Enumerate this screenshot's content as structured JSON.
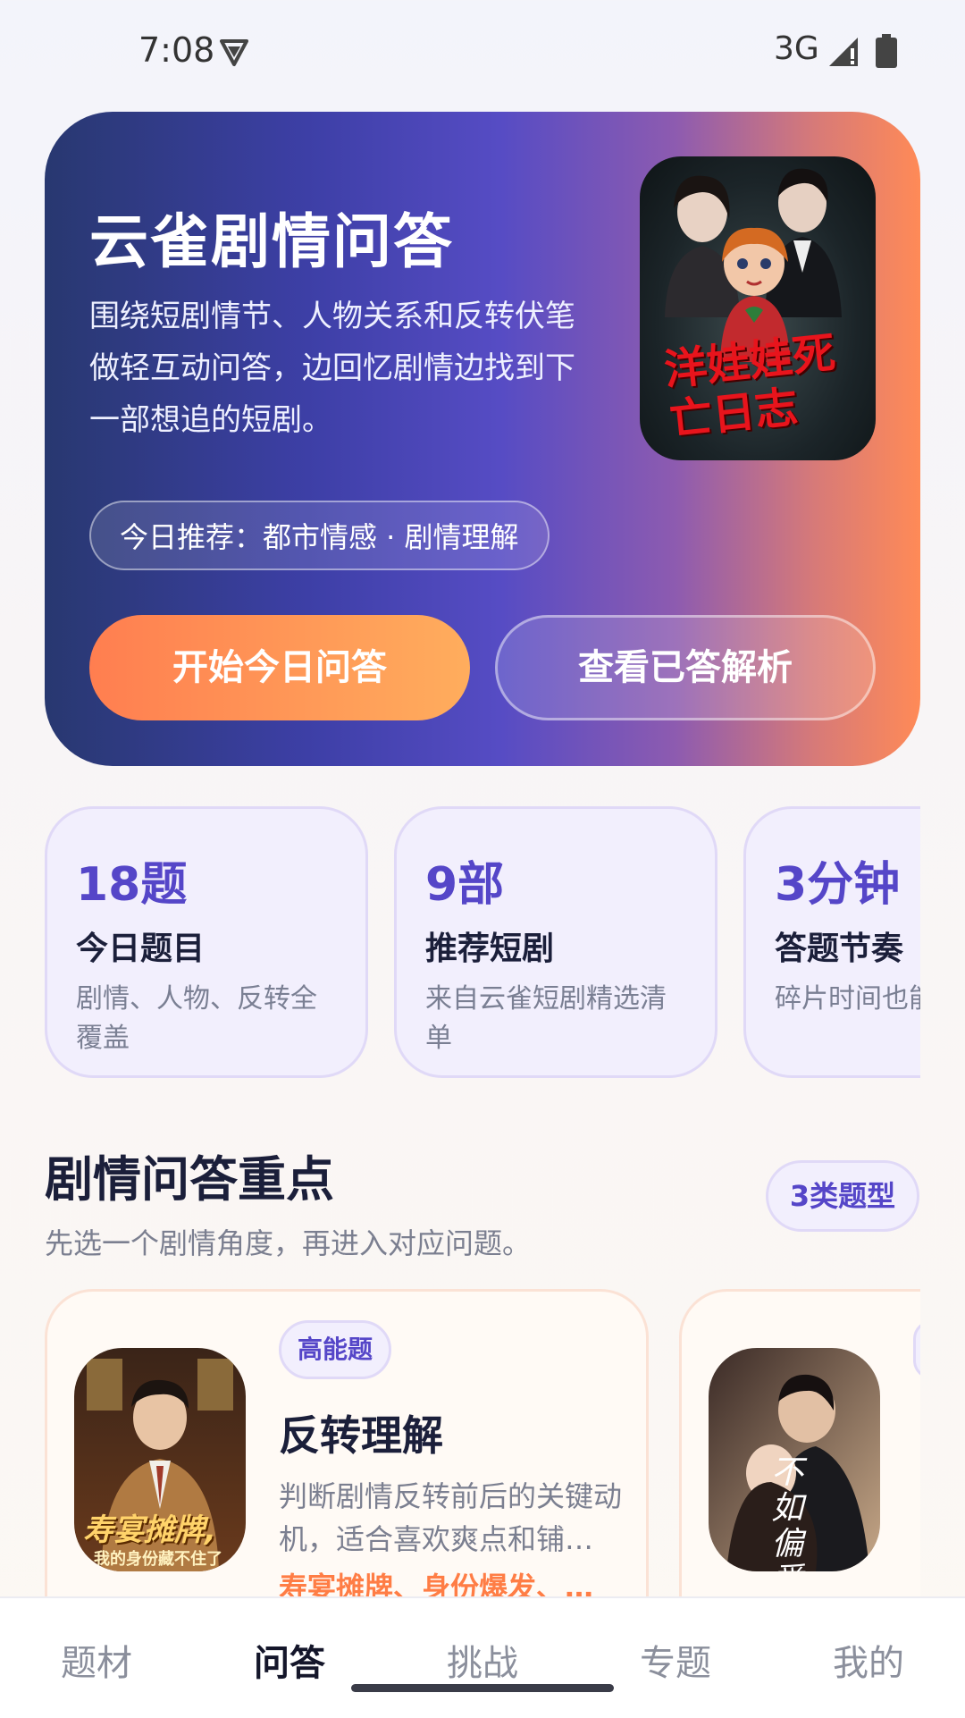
{
  "status_bar": {
    "time": "7:08",
    "network": "3G"
  },
  "hero": {
    "title": "云雀剧情问答",
    "description": "围绕短剧情节、人物关系和反转伏笔做轻互动问答，边回忆剧情边找到下一部想追的短剧。",
    "poster_title": "洋娃娃死亡日志",
    "recommend_tag": "今日推荐：都市情感 · 剧情理解",
    "start_button": "开始今日问答",
    "view_button": "查看已答解析"
  },
  "stats": [
    {
      "value": "18题",
      "label": "今日题目",
      "desc": "剧情、人物、反转全覆盖"
    },
    {
      "value": "9部",
      "label": "推荐短剧",
      "desc": "来自云雀短剧精选清单"
    },
    {
      "value": "3分钟",
      "label": "答题节奏",
      "desc": "碎片时间也能参与"
    }
  ],
  "section": {
    "title": "剧情问答重点",
    "subtitle": "先选一个剧情角度，再进入对应问题。",
    "badge": "3类题型"
  },
  "cards": [
    {
      "chip": "高能题",
      "title": "反转理解",
      "desc": "判断剧情反转前后的关键动机，适合喜欢爽点和铺…",
      "tags": "寿宴摊牌、身份爆发、…",
      "thumb_text": "寿宴摊牌,",
      "thumb_sub": "我的身份藏不住了"
    },
    {
      "chip": "",
      "title": "",
      "desc": "",
      "tags": "",
      "thumb_text": "不如偏爱",
      "thumb_sub": ""
    }
  ],
  "bottom_nav": {
    "items": [
      "题材",
      "问答",
      "挑战",
      "专题",
      "我的"
    ],
    "active": "问答"
  },
  "colors": {
    "accent": "#5546c8",
    "orange": "#ff7d45",
    "hero_start": "#283870",
    "hero_end": "#ff8a57"
  }
}
